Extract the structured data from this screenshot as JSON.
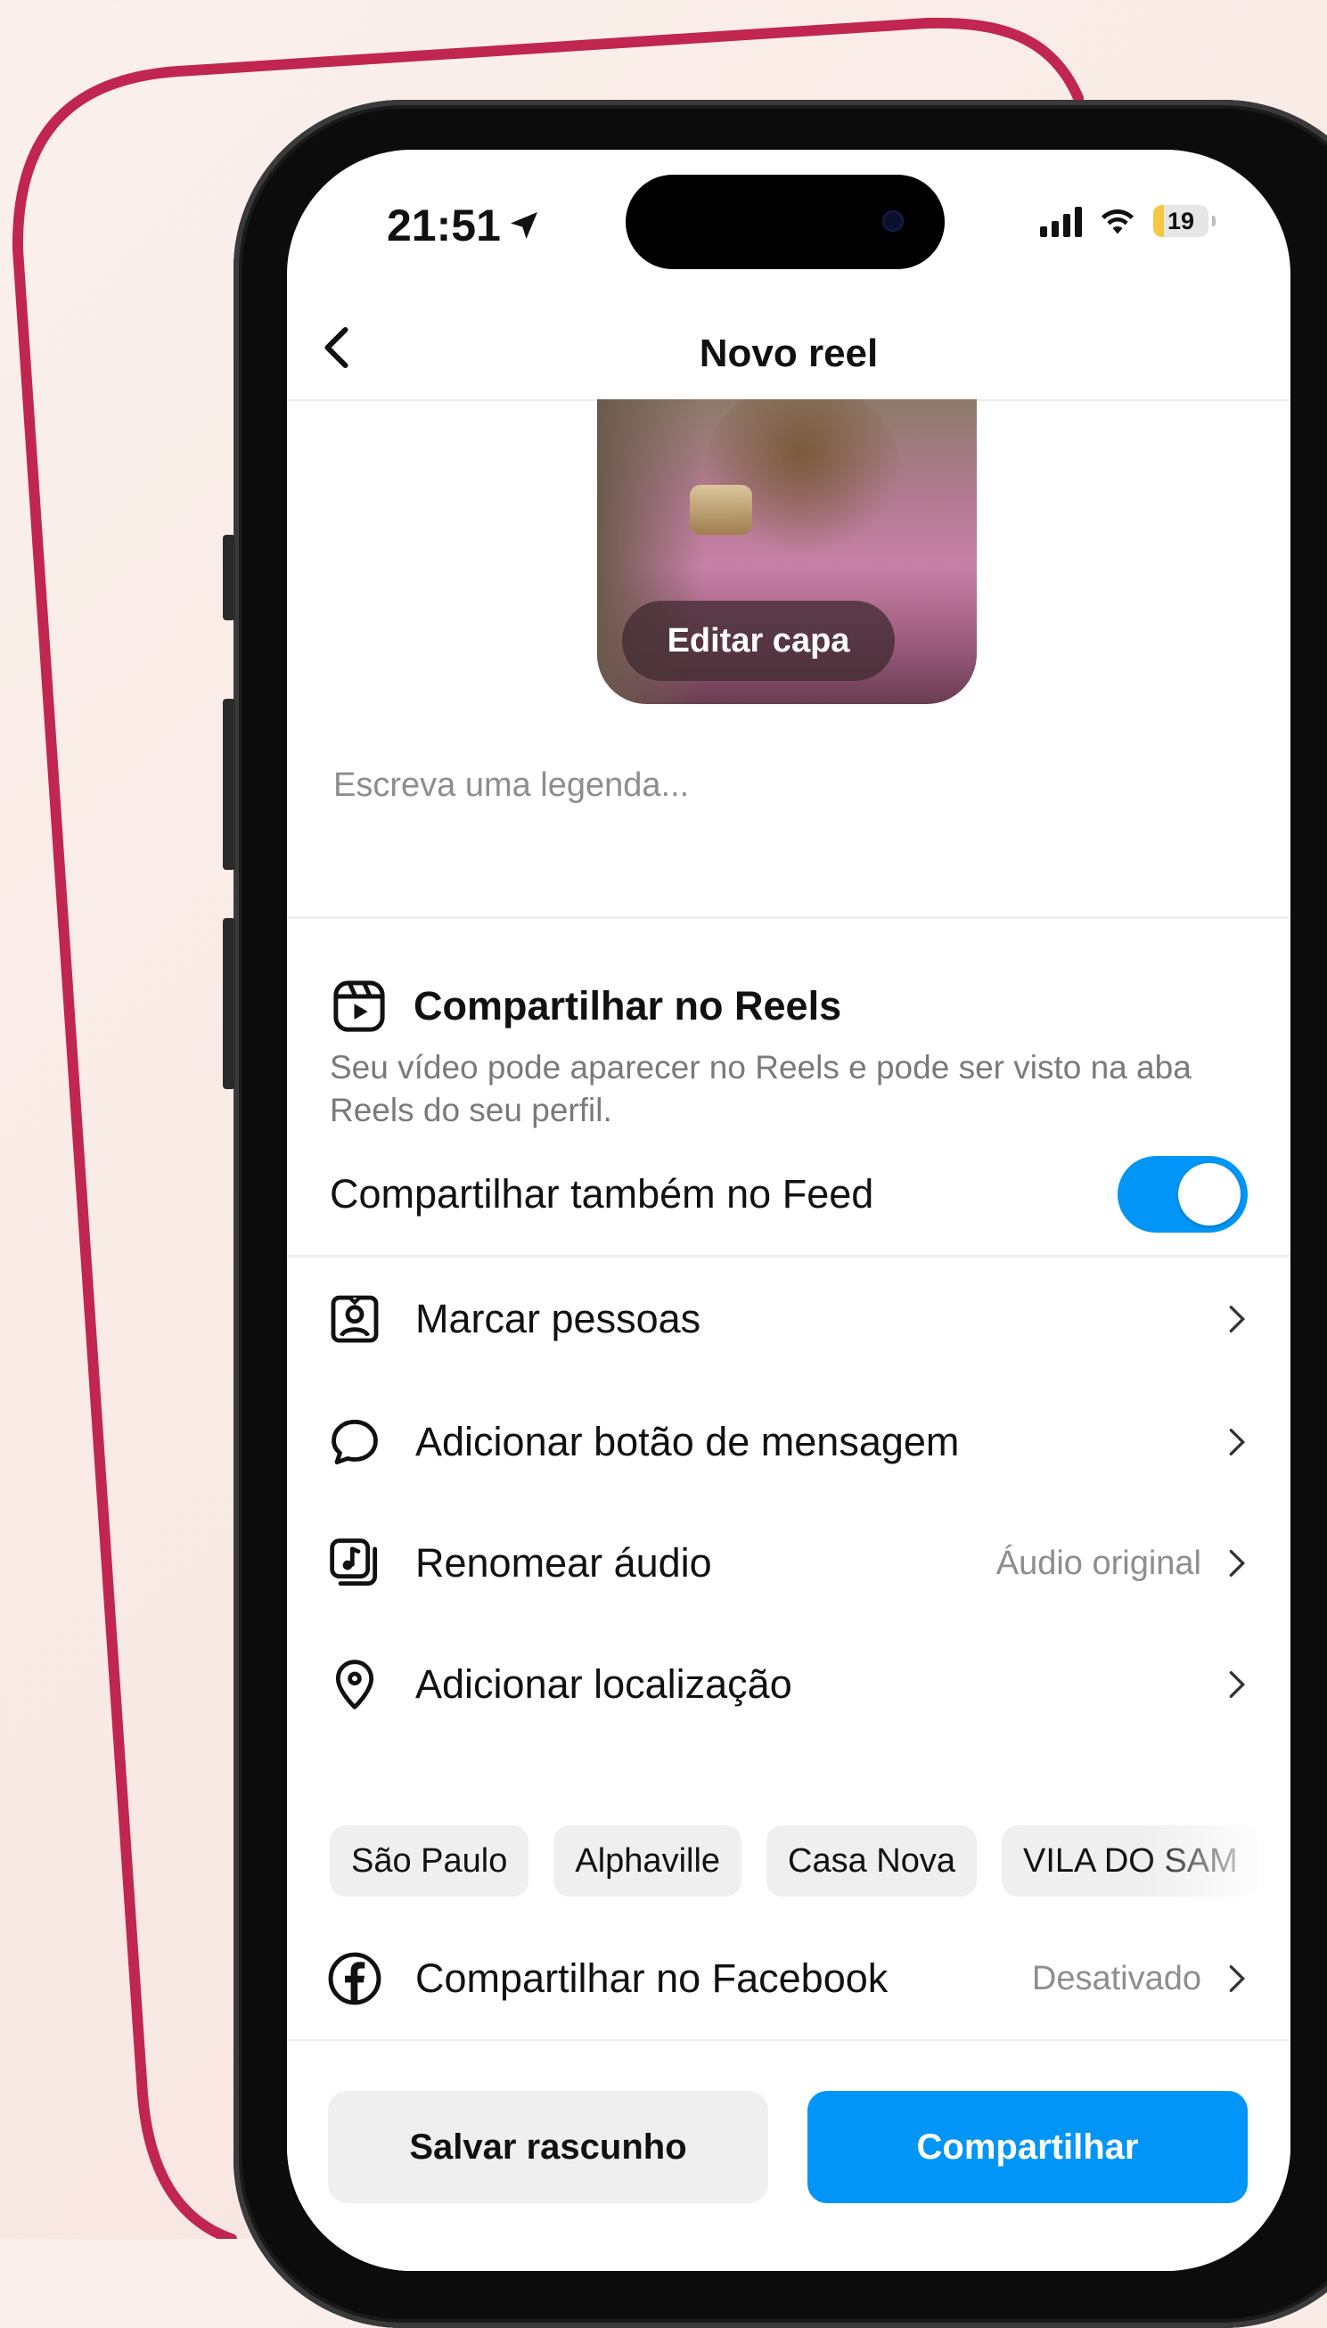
{
  "status_bar": {
    "time": "21:51",
    "battery_level": "19"
  },
  "header": {
    "title": "Novo reel"
  },
  "cover": {
    "edit_label": "Editar capa"
  },
  "caption": {
    "placeholder": "Escreva uma legenda..."
  },
  "reels_section": {
    "title": "Compartilhar no Reels",
    "description": "Seu vídeo pode aparecer no Reels e pode ser visto na aba Reels do seu perfil.",
    "feed_toggle_label": "Compartilhar também no Feed",
    "feed_toggle_on": true
  },
  "menu": [
    {
      "label": "Marcar pessoas",
      "value": "",
      "icon": "tag-people-icon"
    },
    {
      "label": "Adicionar botão de mensagem",
      "value": "",
      "icon": "message-bubble-icon"
    },
    {
      "label": "Renomear áudio",
      "value": "Áudio original",
      "icon": "audio-icon"
    },
    {
      "label": "Adicionar localização",
      "value": "",
      "icon": "location-pin-icon"
    }
  ],
  "location_chips": [
    "São Paulo",
    "Alphaville",
    "Casa Nova",
    "VILA DO SAM"
  ],
  "facebook": {
    "label": "Compartilhar no Facebook",
    "value": "Desativado",
    "icon": "facebook-icon"
  },
  "actions": {
    "draft_label": "Salvar rascunho",
    "share_label": "Compartilhar"
  },
  "colors": {
    "accent": "#0095f6",
    "frame": "#c0264f"
  }
}
